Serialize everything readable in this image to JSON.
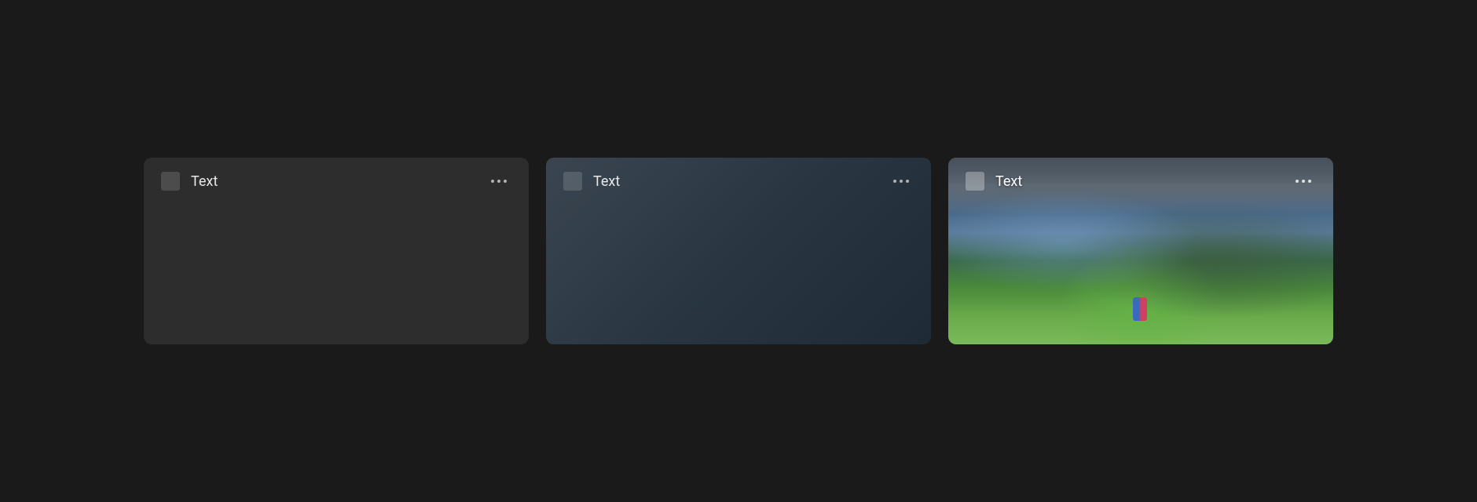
{
  "cards": [
    {
      "title": "Text",
      "variant": "plain"
    },
    {
      "title": "Text",
      "variant": "gradient"
    },
    {
      "title": "Text",
      "variant": "image"
    }
  ]
}
